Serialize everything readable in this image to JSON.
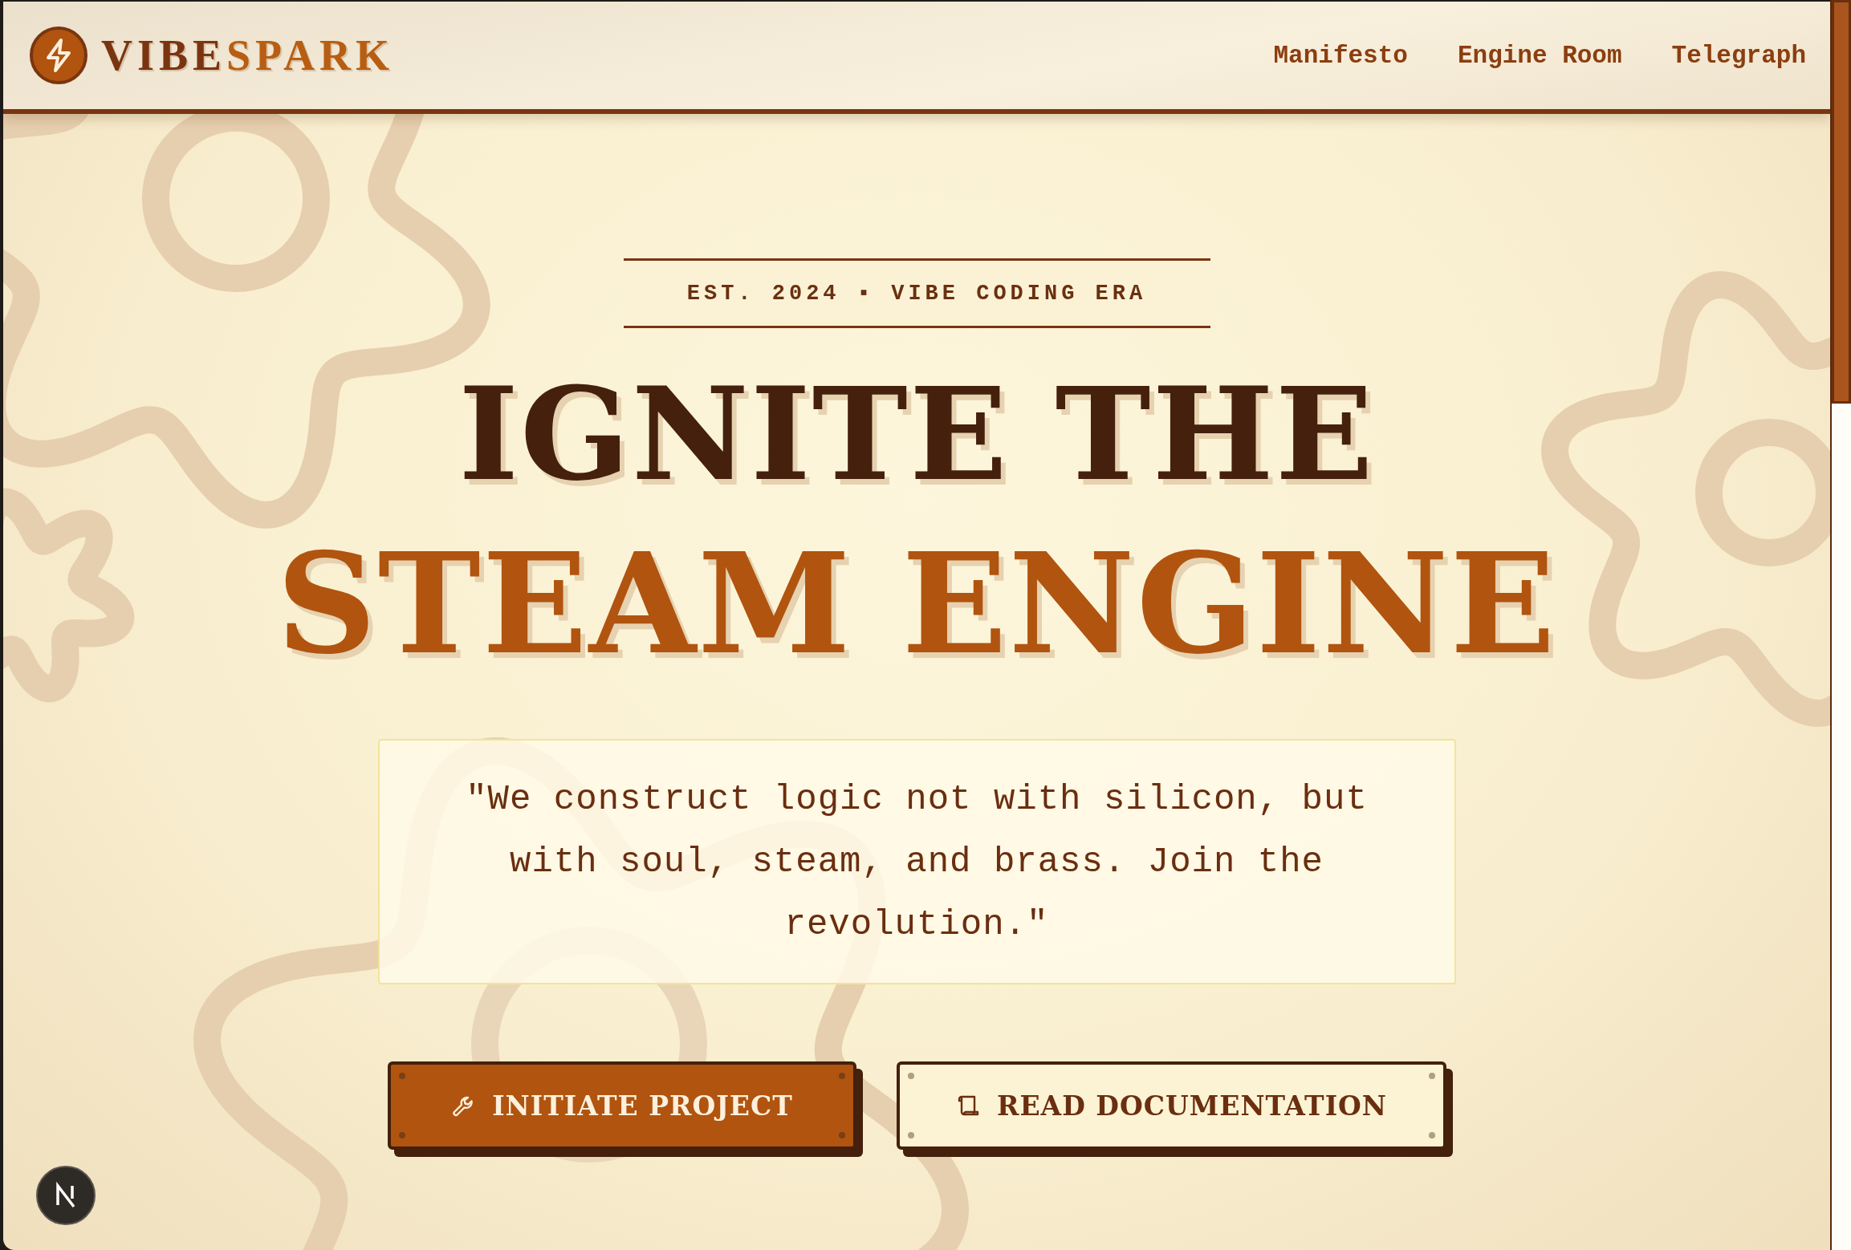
{
  "header": {
    "logo": {
      "first": "VIBE",
      "second": "SPARK"
    },
    "nav": [
      {
        "label": "Manifesto"
      },
      {
        "label": "Engine Room"
      },
      {
        "label": "Telegraph"
      }
    ]
  },
  "hero": {
    "badge": "EST. 2024 ▪ VIBE CODING ERA",
    "headline": [
      {
        "text": "IGNITE THE",
        "kind": "dark"
      },
      {
        "text": "STEAM ENGINE",
        "kind": "accent"
      }
    ],
    "quote": "\"We construct logic not with silicon, but with soul, steam, and brass. Join the revolution.\"",
    "buttons": [
      {
        "label": "INITIATE PROJECT",
        "kind": "primary"
      },
      {
        "label": "READ DOCUMENTATION",
        "kind": "secondary"
      }
    ]
  }
}
